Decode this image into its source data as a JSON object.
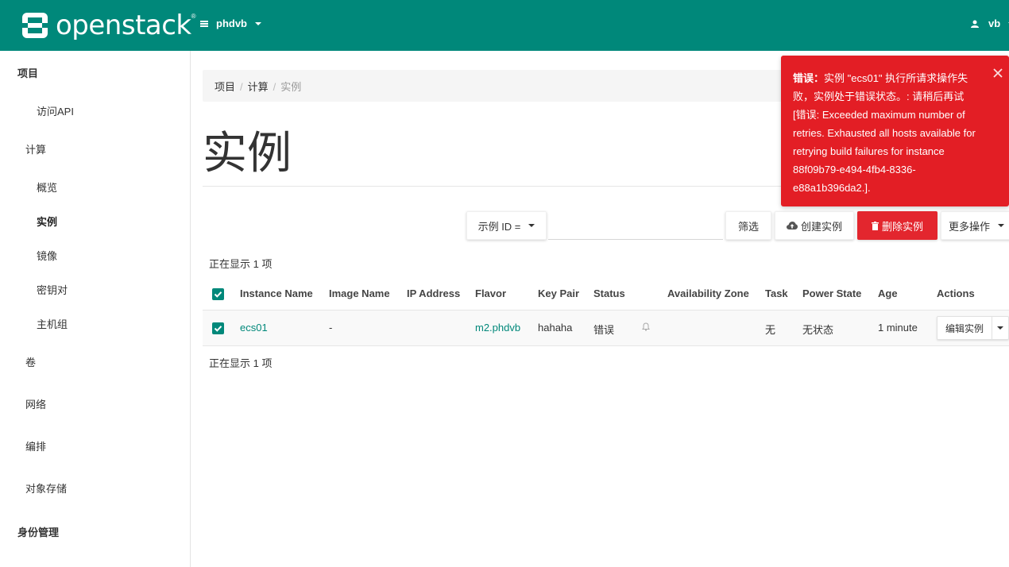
{
  "header": {
    "brand": "openstack",
    "brand_reg": "®",
    "project": "phdvb",
    "user": "vb"
  },
  "sidebar": {
    "project_section": "项目",
    "api_access": "访问API",
    "compute_group": "计算",
    "compute_items": [
      "概览",
      "实例",
      "镜像",
      "密钥对",
      "主机组"
    ],
    "volumes": "卷",
    "network": "网络",
    "orchestration": "编排",
    "object_store": "对象存储",
    "identity_section": "身份管理"
  },
  "breadcrumb": [
    "项目",
    "计算",
    "实例"
  ],
  "breadcrumb_sep": "/",
  "page_title": "实例",
  "toolbar": {
    "filter_field": "示例 ID =",
    "filter_input_placeholder": "",
    "filter_button": "筛选",
    "create_button": "创建实例",
    "delete_button": "删除实例",
    "more_button": "更多操作"
  },
  "count_top": "正在显示 1 项",
  "count_bottom": "正在显示 1 项",
  "table": {
    "headers": [
      "Instance Name",
      "Image Name",
      "IP Address",
      "Flavor",
      "Key Pair",
      "Status",
      "Availability Zone",
      "Task",
      "Power State",
      "Age",
      "Actions"
    ],
    "rows": [
      {
        "name": "ecs01",
        "image": "-",
        "ip": "",
        "flavor": "m2.phdvb",
        "key_pair": "hahaha",
        "status": "错误",
        "zone": "",
        "task": "无",
        "power": "无状态",
        "age": "1 minute",
        "action": "编辑实例"
      }
    ]
  },
  "alert": {
    "prefix": "错误：",
    "message": "实例 \"ecs01\" 执行所请求操作失败，实例处于错误状态。: 请稍后再试 [错误: Exceeded maximum number of retries. Exhausted all hosts available for retrying build failures for instance 88f09b79-e494-4fb4-8336-e88a1b396da2.]."
  },
  "colors": {
    "brand": "#00887a",
    "danger": "#e3262e"
  }
}
